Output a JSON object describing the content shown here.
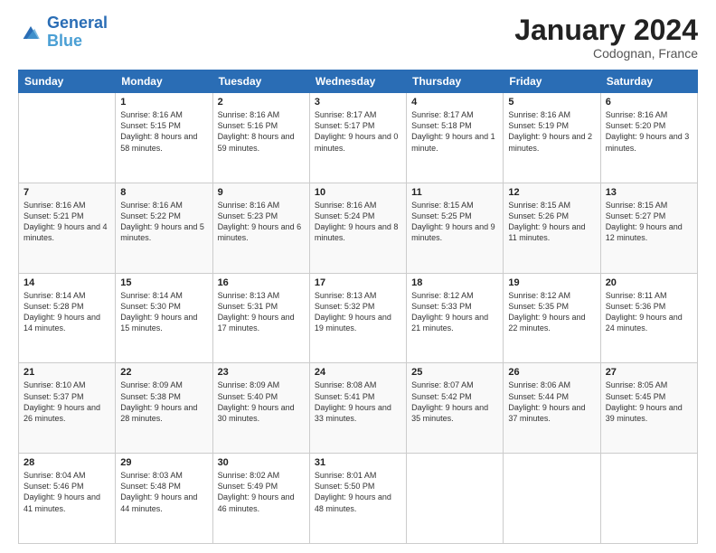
{
  "header": {
    "logo_line1": "General",
    "logo_line2": "Blue",
    "month_title": "January 2024",
    "location": "Codognan, France"
  },
  "days_of_week": [
    "Sunday",
    "Monday",
    "Tuesday",
    "Wednesday",
    "Thursday",
    "Friday",
    "Saturday"
  ],
  "weeks": [
    [
      {
        "day": "",
        "sunrise": "",
        "sunset": "",
        "daylight": ""
      },
      {
        "day": "1",
        "sunrise": "Sunrise: 8:16 AM",
        "sunset": "Sunset: 5:15 PM",
        "daylight": "Daylight: 8 hours and 58 minutes."
      },
      {
        "day": "2",
        "sunrise": "Sunrise: 8:16 AM",
        "sunset": "Sunset: 5:16 PM",
        "daylight": "Daylight: 8 hours and 59 minutes."
      },
      {
        "day": "3",
        "sunrise": "Sunrise: 8:17 AM",
        "sunset": "Sunset: 5:17 PM",
        "daylight": "Daylight: 9 hours and 0 minutes."
      },
      {
        "day": "4",
        "sunrise": "Sunrise: 8:17 AM",
        "sunset": "Sunset: 5:18 PM",
        "daylight": "Daylight: 9 hours and 1 minute."
      },
      {
        "day": "5",
        "sunrise": "Sunrise: 8:16 AM",
        "sunset": "Sunset: 5:19 PM",
        "daylight": "Daylight: 9 hours and 2 minutes."
      },
      {
        "day": "6",
        "sunrise": "Sunrise: 8:16 AM",
        "sunset": "Sunset: 5:20 PM",
        "daylight": "Daylight: 9 hours and 3 minutes."
      }
    ],
    [
      {
        "day": "7",
        "sunrise": "Sunrise: 8:16 AM",
        "sunset": "Sunset: 5:21 PM",
        "daylight": "Daylight: 9 hours and 4 minutes."
      },
      {
        "day": "8",
        "sunrise": "Sunrise: 8:16 AM",
        "sunset": "Sunset: 5:22 PM",
        "daylight": "Daylight: 9 hours and 5 minutes."
      },
      {
        "day": "9",
        "sunrise": "Sunrise: 8:16 AM",
        "sunset": "Sunset: 5:23 PM",
        "daylight": "Daylight: 9 hours and 6 minutes."
      },
      {
        "day": "10",
        "sunrise": "Sunrise: 8:16 AM",
        "sunset": "Sunset: 5:24 PM",
        "daylight": "Daylight: 9 hours and 8 minutes."
      },
      {
        "day": "11",
        "sunrise": "Sunrise: 8:15 AM",
        "sunset": "Sunset: 5:25 PM",
        "daylight": "Daylight: 9 hours and 9 minutes."
      },
      {
        "day": "12",
        "sunrise": "Sunrise: 8:15 AM",
        "sunset": "Sunset: 5:26 PM",
        "daylight": "Daylight: 9 hours and 11 minutes."
      },
      {
        "day": "13",
        "sunrise": "Sunrise: 8:15 AM",
        "sunset": "Sunset: 5:27 PM",
        "daylight": "Daylight: 9 hours and 12 minutes."
      }
    ],
    [
      {
        "day": "14",
        "sunrise": "Sunrise: 8:14 AM",
        "sunset": "Sunset: 5:28 PM",
        "daylight": "Daylight: 9 hours and 14 minutes."
      },
      {
        "day": "15",
        "sunrise": "Sunrise: 8:14 AM",
        "sunset": "Sunset: 5:30 PM",
        "daylight": "Daylight: 9 hours and 15 minutes."
      },
      {
        "day": "16",
        "sunrise": "Sunrise: 8:13 AM",
        "sunset": "Sunset: 5:31 PM",
        "daylight": "Daylight: 9 hours and 17 minutes."
      },
      {
        "day": "17",
        "sunrise": "Sunrise: 8:13 AM",
        "sunset": "Sunset: 5:32 PM",
        "daylight": "Daylight: 9 hours and 19 minutes."
      },
      {
        "day": "18",
        "sunrise": "Sunrise: 8:12 AM",
        "sunset": "Sunset: 5:33 PM",
        "daylight": "Daylight: 9 hours and 21 minutes."
      },
      {
        "day": "19",
        "sunrise": "Sunrise: 8:12 AM",
        "sunset": "Sunset: 5:35 PM",
        "daylight": "Daylight: 9 hours and 22 minutes."
      },
      {
        "day": "20",
        "sunrise": "Sunrise: 8:11 AM",
        "sunset": "Sunset: 5:36 PM",
        "daylight": "Daylight: 9 hours and 24 minutes."
      }
    ],
    [
      {
        "day": "21",
        "sunrise": "Sunrise: 8:10 AM",
        "sunset": "Sunset: 5:37 PM",
        "daylight": "Daylight: 9 hours and 26 minutes."
      },
      {
        "day": "22",
        "sunrise": "Sunrise: 8:09 AM",
        "sunset": "Sunset: 5:38 PM",
        "daylight": "Daylight: 9 hours and 28 minutes."
      },
      {
        "day": "23",
        "sunrise": "Sunrise: 8:09 AM",
        "sunset": "Sunset: 5:40 PM",
        "daylight": "Daylight: 9 hours and 30 minutes."
      },
      {
        "day": "24",
        "sunrise": "Sunrise: 8:08 AM",
        "sunset": "Sunset: 5:41 PM",
        "daylight": "Daylight: 9 hours and 33 minutes."
      },
      {
        "day": "25",
        "sunrise": "Sunrise: 8:07 AM",
        "sunset": "Sunset: 5:42 PM",
        "daylight": "Daylight: 9 hours and 35 minutes."
      },
      {
        "day": "26",
        "sunrise": "Sunrise: 8:06 AM",
        "sunset": "Sunset: 5:44 PM",
        "daylight": "Daylight: 9 hours and 37 minutes."
      },
      {
        "day": "27",
        "sunrise": "Sunrise: 8:05 AM",
        "sunset": "Sunset: 5:45 PM",
        "daylight": "Daylight: 9 hours and 39 minutes."
      }
    ],
    [
      {
        "day": "28",
        "sunrise": "Sunrise: 8:04 AM",
        "sunset": "Sunset: 5:46 PM",
        "daylight": "Daylight: 9 hours and 41 minutes."
      },
      {
        "day": "29",
        "sunrise": "Sunrise: 8:03 AM",
        "sunset": "Sunset: 5:48 PM",
        "daylight": "Daylight: 9 hours and 44 minutes."
      },
      {
        "day": "30",
        "sunrise": "Sunrise: 8:02 AM",
        "sunset": "Sunset: 5:49 PM",
        "daylight": "Daylight: 9 hours and 46 minutes."
      },
      {
        "day": "31",
        "sunrise": "Sunrise: 8:01 AM",
        "sunset": "Sunset: 5:50 PM",
        "daylight": "Daylight: 9 hours and 48 minutes."
      },
      {
        "day": "",
        "sunrise": "",
        "sunset": "",
        "daylight": ""
      },
      {
        "day": "",
        "sunrise": "",
        "sunset": "",
        "daylight": ""
      },
      {
        "day": "",
        "sunrise": "",
        "sunset": "",
        "daylight": ""
      }
    ]
  ]
}
